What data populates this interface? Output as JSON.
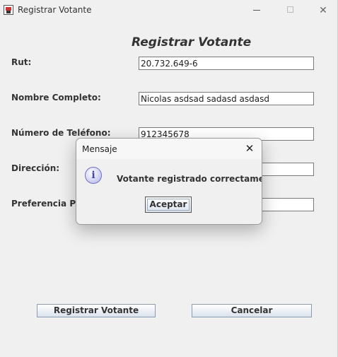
{
  "window": {
    "title": "Registrar Votante",
    "controls": {
      "minimize": "—",
      "maximize": "",
      "close": "✕"
    }
  },
  "form": {
    "title": "Registrar Votante",
    "fields": [
      {
        "label": "Rut:",
        "value": "20.732.649-6"
      },
      {
        "label": "Nombre Completo:",
        "value": "Nicolas asdsad sadasd asdasd"
      },
      {
        "label": "Número de Teléfono:",
        "value": "912345678"
      },
      {
        "label": "Dirección:",
        "value": ""
      },
      {
        "label": "Preferencia Polí",
        "value": ""
      }
    ],
    "buttons": {
      "register": "Registrar Votante",
      "cancel": "Cancelar"
    }
  },
  "dialog": {
    "title": "Mensaje",
    "close": "✕",
    "icon": "i",
    "message": "Votante registrado correctamente",
    "ok": "Aceptar"
  }
}
